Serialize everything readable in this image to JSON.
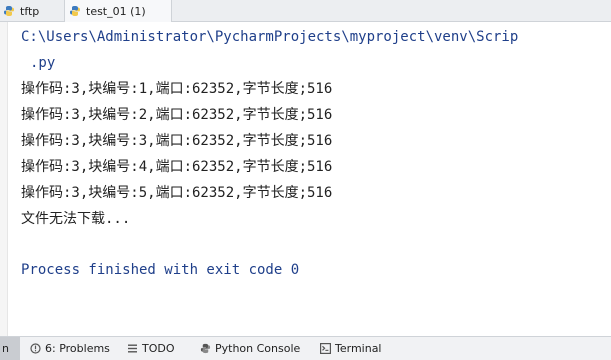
{
  "tabs": [
    {
      "label": "tftp",
      "icon": "python-file-icon"
    },
    {
      "label": "test_01 (1)",
      "icon": "python-file-icon"
    }
  ],
  "console": {
    "command_path": "C:\\Users\\Administrator\\PycharmProjects\\myproject\\venv\\Scrip",
    "command_tail": ".py",
    "lines": [
      "操作码:3,块编号:1,端口:62352,字节长度;516",
      "操作码:3,块编号:2,端口:62352,字节长度;516",
      "操作码:3,块编号:3,端口:62352,字节长度;516",
      "操作码:3,块编号:4,端口:62352,字节长度;516",
      "操作码:3,块编号:5,端口:62352,字节长度;516"
    ],
    "failure_message": "文件无法下载...",
    "exit_message": "Process finished with exit code 0"
  },
  "bottom_bar": {
    "edge_label": "n",
    "items": [
      {
        "label": "6: Problems",
        "icon": "problems-icon"
      },
      {
        "label": "TODO",
        "icon": "todo-list-icon"
      },
      {
        "label": "Python Console",
        "icon": "python-console-icon"
      },
      {
        "label": "Terminal",
        "icon": "terminal-icon"
      }
    ]
  },
  "colors": {
    "console_link_blue": "#1f3f8a",
    "python_blue": "#3d7bbf",
    "python_yellow": "#f2c94c"
  }
}
